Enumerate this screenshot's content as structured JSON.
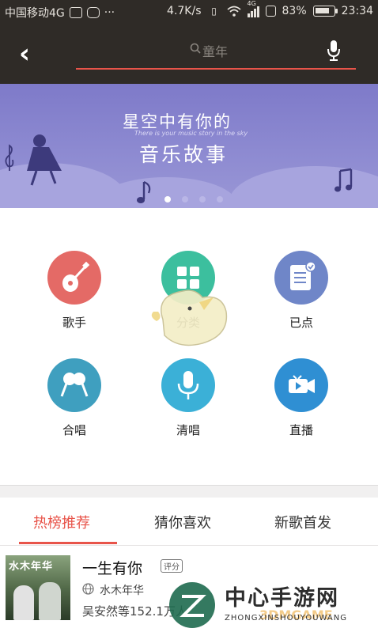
{
  "status_bar": {
    "carrier": "中国移动4G",
    "network_speed": "4.7K/s",
    "signal_type": "4G",
    "battery_percent": "83%",
    "battery_level": 0.83,
    "time": "23:34",
    "icons": [
      "image-icon",
      "cat-icon",
      "more-dots-icon",
      "vibrate-icon",
      "wifi-icon",
      "signal-icon",
      "sim-icon",
      "battery-icon"
    ]
  },
  "header": {
    "back_icon": "back-arrow-icon",
    "search_placeholder": "童年",
    "search_icon": "search-icon",
    "voice_icon": "microphone-icon",
    "accent_color": "#e8544a"
  },
  "banner": {
    "title_line1": "星空中有你的",
    "subtitle": "There is your music story in the sky",
    "title_line2": "音乐故事",
    "page_count": 4,
    "active_page": 1
  },
  "categories": [
    {
      "label": "歌手",
      "icon": "guitar-icon",
      "color": "#e46a66"
    },
    {
      "label": "分类",
      "icon": "grid-icon",
      "color": "#3cbf9e"
    },
    {
      "label": "已点",
      "icon": "list-check-icon",
      "color": "#6f86c8"
    },
    {
      "label": "合唱",
      "icon": "duet-mic-icon",
      "color": "#3f9fbf"
    },
    {
      "label": "清唱",
      "icon": "microphone-icon",
      "color": "#3bb0d7"
    },
    {
      "label": "直播",
      "icon": "video-camera-icon",
      "color": "#2f8fd3"
    }
  ],
  "tabs": [
    {
      "label": "热榜推荐",
      "active": true
    },
    {
      "label": "猜你喜欢",
      "active": false
    },
    {
      "label": "新歌首发",
      "active": false
    }
  ],
  "song": {
    "cover_text": "水木年华",
    "title": "一生有你",
    "tag": "评分",
    "singer": "水木年华",
    "desc": "吴安然等152.1万人"
  },
  "watermark": {
    "text": "中心手游网",
    "sub": "ZHONGXINSHOUYOUWANG",
    "logo_text": "3DMGAME"
  }
}
